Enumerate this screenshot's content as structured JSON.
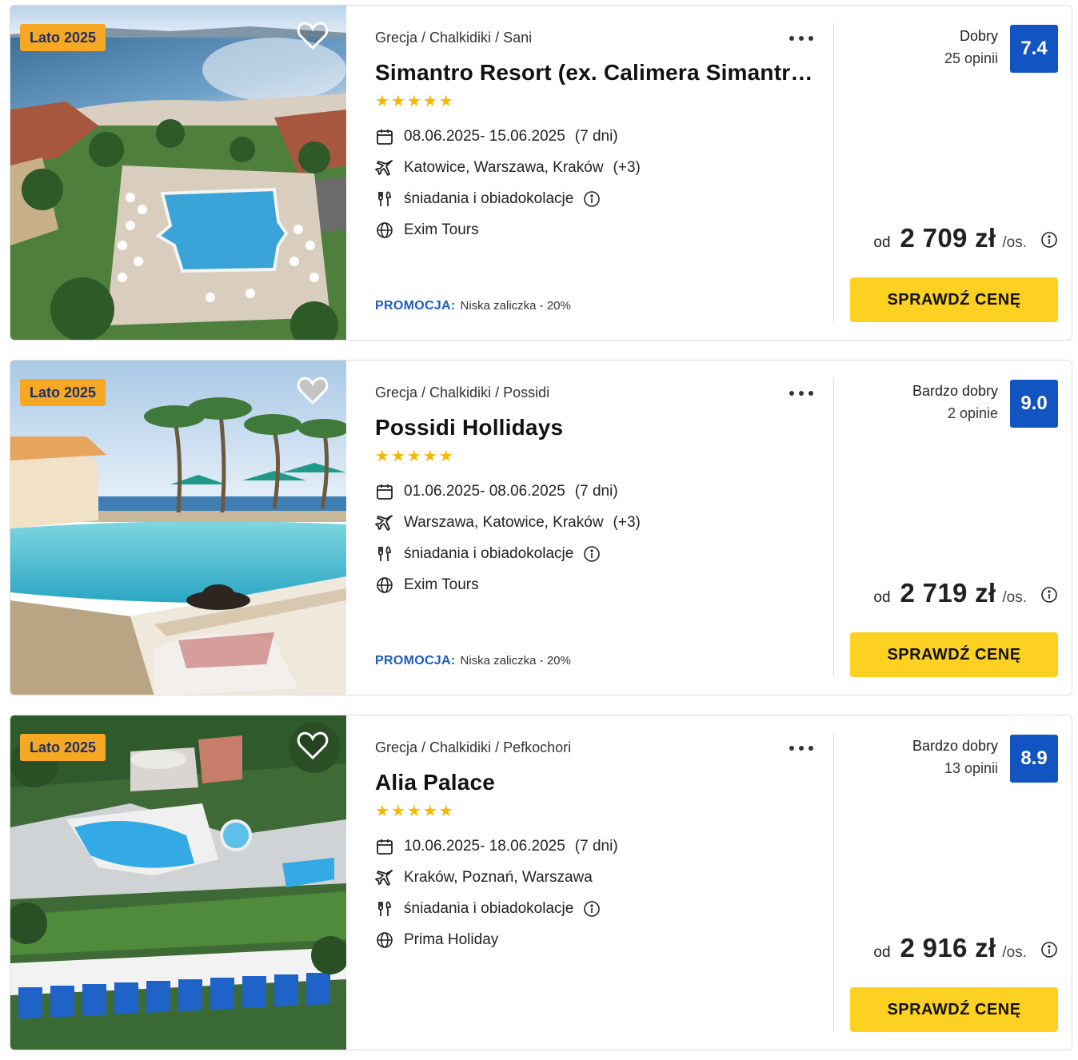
{
  "offers": [
    {
      "badge": "Lato 2025",
      "breadcrumb": [
        "Grecja",
        "Chalkidiki",
        "Sani"
      ],
      "breadcrumb_separator": "/",
      "name": "Simantro Resort (ex. Calimera Simantro Beach)",
      "stars": 5,
      "dates": "08.06.2025- 15.06.2025",
      "duration": "(7 dni)",
      "departures": "Katowice, Warszawa, Kraków",
      "departures_more": "(+3)",
      "board": "śniadania i obiadokolacje",
      "operator": "Exim Tours",
      "promo_label": "PROMOCJA:",
      "promo_value": "Niska zaliczka - 20%",
      "rating_label": "Dobry",
      "rating_count": "25 opinii",
      "score": "7.4",
      "price_prefix": "od",
      "price": "2 709 zł",
      "price_suffix": "/os.",
      "cta": "SPRAWDŹ CENĘ",
      "favorite": false
    },
    {
      "badge": "Lato 2025",
      "breadcrumb": [
        "Grecja",
        "Chalkidiki",
        "Possidi"
      ],
      "breadcrumb_separator": "/",
      "name": "Possidi Hollidays",
      "stars": 5,
      "dates": "01.06.2025- 08.06.2025",
      "duration": "(7 dni)",
      "departures": "Warszawa, Katowice, Kraków",
      "departures_more": "(+3)",
      "board": "śniadania i obiadokolacje",
      "operator": "Exim Tours",
      "promo_label": "PROMOCJA:",
      "promo_value": "Niska zaliczka - 20%",
      "rating_label": "Bardzo dobry",
      "rating_count": "2 opinie",
      "score": "9.0",
      "price_prefix": "od",
      "price": "2 719 zł",
      "price_suffix": "/os.",
      "cta": "SPRAWDŹ CENĘ",
      "favorite": false
    },
    {
      "badge": "Lato 2025",
      "breadcrumb": [
        "Grecja",
        "Chalkidiki",
        "Pefkochori"
      ],
      "breadcrumb_separator": "/",
      "name": "Alia Palace",
      "stars": 5,
      "dates": "10.06.2025- 18.06.2025",
      "duration": "(7 dni)",
      "departures": "Kraków, Poznań, Warszawa",
      "departures_more": "",
      "board": "śniadania i obiadokolacje",
      "operator": "Prima Holiday",
      "promo_label": "",
      "promo_value": "",
      "rating_label": "Bardzo dobry",
      "rating_count": "13 opinii",
      "score": "8.9",
      "price_prefix": "od",
      "price": "2 916 zł",
      "price_suffix": "/os.",
      "cta": "SPRAWDŹ CENĘ",
      "favorite": false
    }
  ],
  "colors": {
    "badge_bg": "#f7a823",
    "badge_text": "#1d2f66",
    "score_bg": "#1254c1",
    "cta_bg": "#fcd121",
    "promo_label": "#1d5bbf",
    "star": "#f5b800"
  },
  "icons": {
    "dates": "calendar-icon",
    "departures": "plane-icon",
    "board": "cutlery-icon",
    "operator": "globe-icon",
    "info": "info-icon",
    "favorite": "heart-icon",
    "more": "more-dots-icon"
  }
}
